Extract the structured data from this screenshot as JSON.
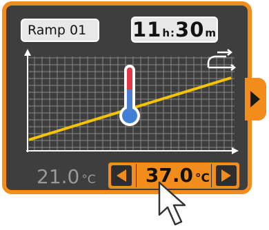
{
  "program": {
    "name": "Ramp 01"
  },
  "time": {
    "hours": "11",
    "hours_unit": "h:",
    "minutes": "30",
    "minutes_unit": "m"
  },
  "temperature": {
    "start_value": "21.0",
    "start_unit": "°C",
    "target_value": "37.0",
    "target_unit": "°C"
  },
  "icons": {
    "ramp_mode": "ramp-mode-icon",
    "thermometer": "thermometer-icon",
    "next": "arrow-right-icon",
    "decrease": "triangle-left-icon",
    "increase": "triangle-right-icon",
    "cursor": "mouse-pointer-icon"
  },
  "colors": {
    "frame": "#f28c1a",
    "screen": "#3e3e3e",
    "ramp_line": "#f5c400",
    "grid": "#8a8a8a",
    "start_temp_text": "#9a9a9a"
  }
}
